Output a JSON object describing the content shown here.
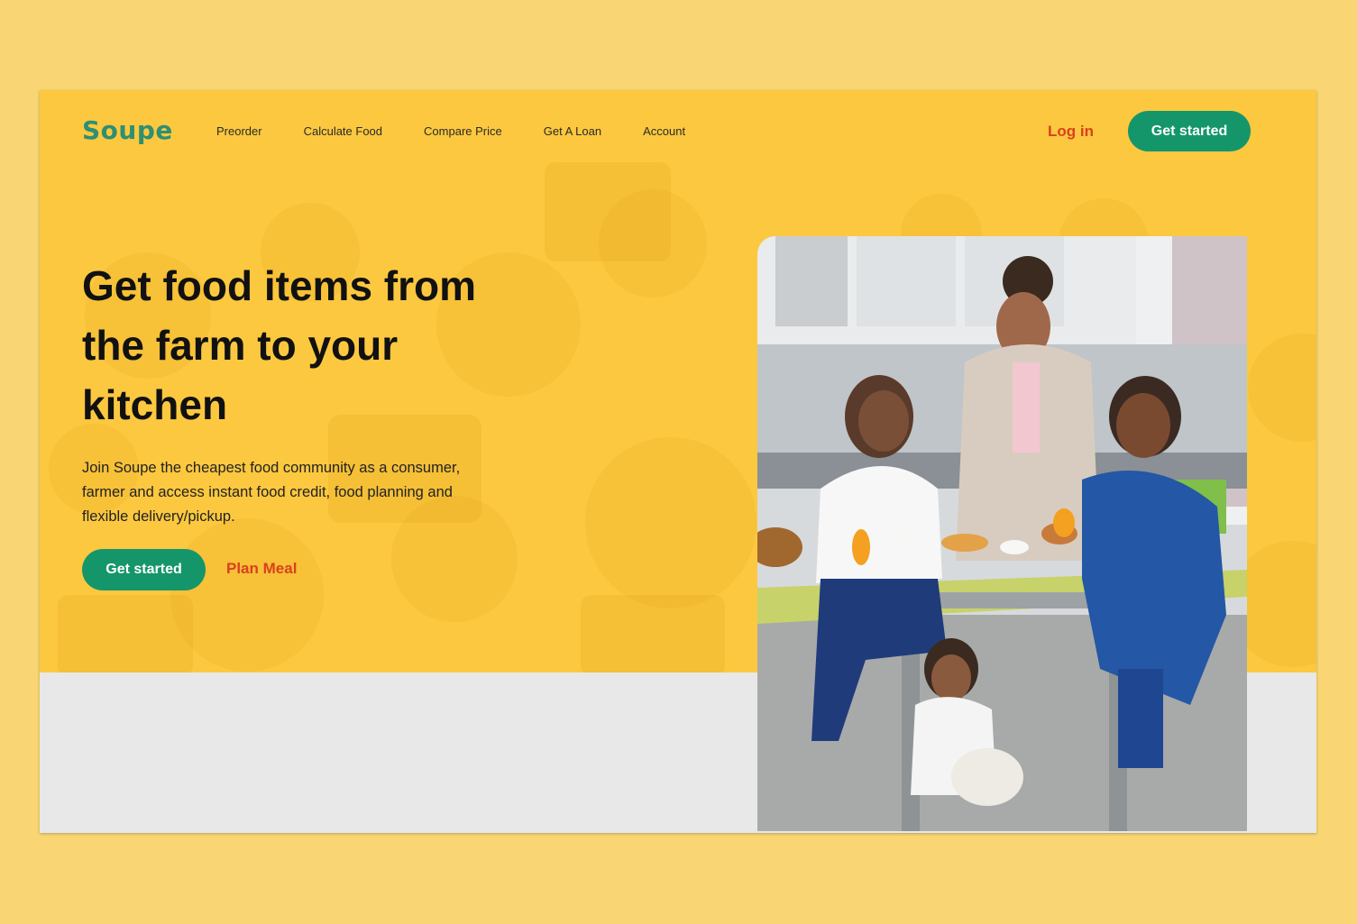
{
  "brand": {
    "name": "Soupe",
    "color": "#2f8f72"
  },
  "nav": {
    "links": [
      "Preorder",
      "Calculate Food",
      "Compare Price",
      "Get A Loan",
      "Account"
    ],
    "login_label": "Log in",
    "cta_label": "Get started"
  },
  "hero": {
    "headline": "Get food items from the farm to your kitchen",
    "description": "Join Soupe the cheapest food community as a consumer, farmer and access instant food credit, food planning and flexible delivery/pickup.",
    "primary_cta": "Get started",
    "secondary_cta": "Plan Meal"
  },
  "colors": {
    "page_bg": "#f9d673",
    "hero_bg": "#fcc83f",
    "accent_green": "#14966a",
    "accent_red": "#d9411e",
    "lower_bg": "#e8e8e8"
  },
  "image": {
    "icon": "family-breakfast-photo"
  }
}
